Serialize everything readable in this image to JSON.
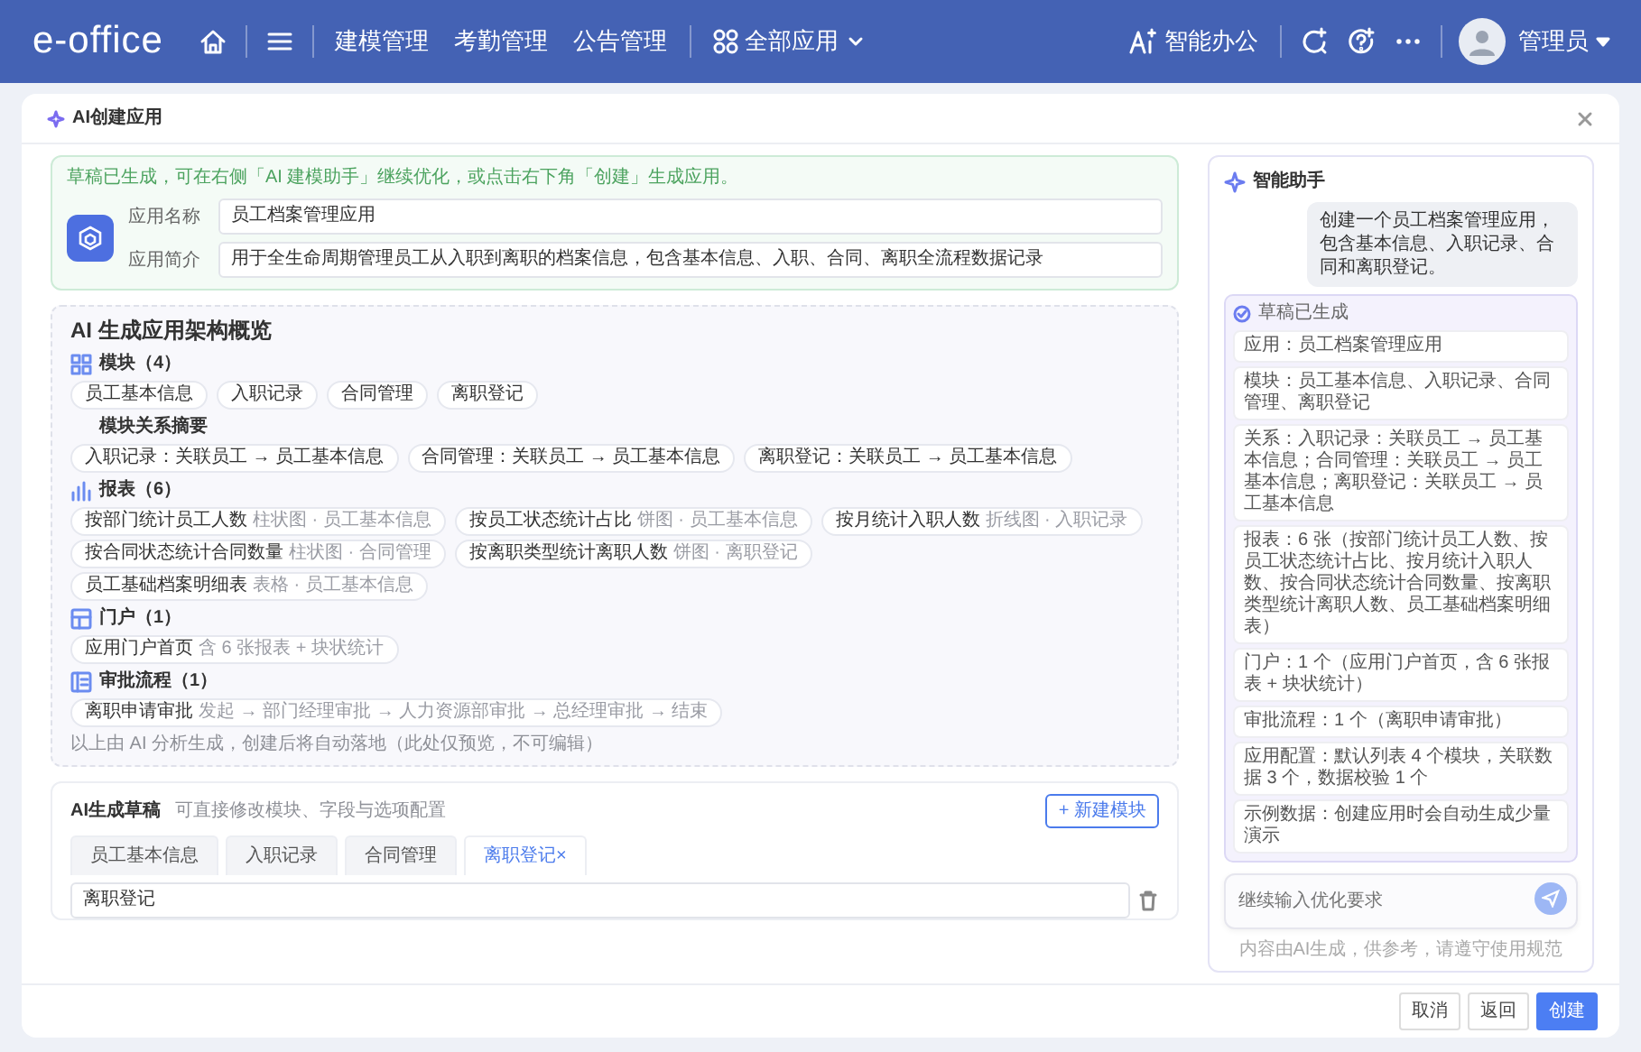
{
  "navbar": {
    "logo": "e-office",
    "nav": [
      {
        "kind": "home"
      },
      {
        "kind": "menu"
      },
      {
        "kind": "link",
        "label": "建模管理"
      },
      {
        "kind": "link",
        "label": "考勤管理"
      },
      {
        "kind": "link",
        "label": "公告管理"
      },
      {
        "kind": "apps",
        "label": "全部应用"
      }
    ],
    "tools": [
      {
        "kind": "ai",
        "label": "智能办公"
      },
      {
        "kind": "spark"
      },
      {
        "kind": "help"
      },
      {
        "kind": "more"
      }
    ],
    "user": {
      "name": "管理员"
    }
  },
  "dialog": {
    "title": "AI创建应用",
    "notice": "草稿已生成，可在右侧「AI 建模助手」继续优化，或点击右下角「创建」生成应用。",
    "app_fields": [
      {
        "label": "应用名称",
        "value": "员工档案管理应用"
      },
      {
        "label": "应用简介",
        "value": "用于全生命周期管理员工从入职到离职的档案信息，包含基本信息、入职、合同、离职全流程数据记录"
      }
    ],
    "overview": {
      "title": "AI 生成应用架构概览",
      "sections": [
        {
          "kind": "modules",
          "title": "模块（4）",
          "chips": [
            {
              "label": "员工基本信息"
            },
            {
              "label": "入职记录"
            },
            {
              "label": "合同管理"
            },
            {
              "label": "离职登记"
            }
          ],
          "relations": {
            "title": "模块关系摘要",
            "chips": [
              {
                "label": "入职记录：关联员工 → 员工基本信息"
              },
              {
                "label": "合同管理：关联员工 → 员工基本信息"
              },
              {
                "label": "离职登记：关联员工 → 员工基本信息"
              }
            ]
          }
        },
        {
          "kind": "reports",
          "title": "报表（6）",
          "chips": [
            {
              "label": "按部门统计员工人数",
              "meta": "柱状图 · 员工基本信息"
            },
            {
              "label": "按员工状态统计占比",
              "meta": "饼图 · 员工基本信息"
            },
            {
              "label": "按月统计入职人数",
              "meta": "折线图 · 入职记录"
            },
            {
              "label": "按合同状态统计合同数量",
              "meta": "柱状图 · 合同管理"
            },
            {
              "label": "按离职类型统计离职人数",
              "meta": "饼图 · 离职登记"
            },
            {
              "label": "员工基础档案明细表",
              "meta": "表格 · 员工基本信息"
            }
          ]
        },
        {
          "kind": "portal",
          "title": "门户（1）",
          "chips": [
            {
              "label": "应用门户首页",
              "meta": "含 6 张报表 + 块状统计"
            }
          ]
        },
        {
          "kind": "workflow",
          "title": "审批流程（1）",
          "chips": [
            {
              "label": "离职申请审批",
              "meta": "发起 → 部门经理审批 → 人力资源部审批 → 总经理审批 → 结束"
            }
          ]
        }
      ],
      "footnote": "以上由 AI 分析生成，创建后将自动落地（此处仅预览，不可编辑）"
    },
    "draft": {
      "title": "AI生成草稿",
      "hint": "可直接修改模块、字段与选项配置",
      "add_button": "+ 新建模块",
      "tabs": [
        {
          "label": "员工基本信息",
          "selected": false
        },
        {
          "label": "入职记录",
          "selected": false
        },
        {
          "label": "合同管理",
          "selected": false
        },
        {
          "label": "离职登记",
          "selected": true,
          "close": "×"
        }
      ],
      "module_name": "离职登记"
    },
    "assistant": {
      "title": "智能助手",
      "user_message": "创建一个员工档案管理应用，包含基本信息、入职记录、合同和离职登记。",
      "draft_status": "草稿已生成",
      "items": [
        "应用：员工档案管理应用",
        "模块：员工基本信息、入职记录、合同管理、离职登记",
        "关系：入职记录：关联员工 → 员工基本信息；合同管理：关联员工 → 员工基本信息；离职登记：关联员工 → 员工基本信息",
        "报表：6 张（按部门统计员工人数、按员工状态统计占比、按月统计入职人数、按合同状态统计合同数量、按离职类型统计离职人数、员工基础档案明细表）",
        "门户：1 个（应用门户首页，含 6 张报表 + 块状统计）",
        "审批流程：1 个（离职申请审批）",
        "应用配置：默认列表 4 个模块，关联数据 3 个，数据校验 1 个",
        "示例数据：创建应用时会自动生成少量演示"
      ],
      "input_placeholder": "继续输入优化要求",
      "disclaimer": "内容由AI生成，供参考，请遵守使用规范"
    },
    "buttons": [
      {
        "label": "取消",
        "kind": "secondary"
      },
      {
        "label": "返回",
        "kind": "secondary"
      },
      {
        "label": "创建",
        "kind": "primary"
      }
    ]
  }
}
